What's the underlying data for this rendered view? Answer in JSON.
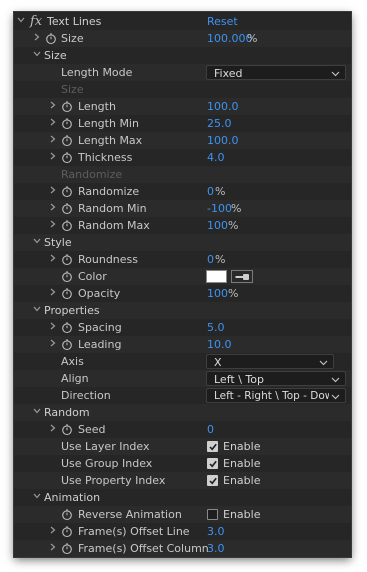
{
  "effect": {
    "name": "Text Lines",
    "reset_label": "Reset"
  },
  "params": {
    "size_root": {
      "label": "Size",
      "value": "100.000",
      "unit": "%"
    },
    "size_group": {
      "label": "Size",
      "length_mode": {
        "label": "Length Mode",
        "value": "Fixed"
      },
      "subhead": "Size",
      "length": {
        "label": "Length",
        "value": "100.0"
      },
      "length_min": {
        "label": "Length Min",
        "value": "25.0"
      },
      "length_max": {
        "label": "Length Max",
        "value": "100.0"
      },
      "thickness": {
        "label": "Thickness",
        "value": "4.0"
      },
      "subhead2": "Randomize",
      "randomize": {
        "label": "Randomize",
        "value": "0",
        "unit": "%"
      },
      "random_min": {
        "label": "Random Min",
        "value": "-100",
        "unit": "%"
      },
      "random_max": {
        "label": "Random Max",
        "value": "100",
        "unit": "%"
      }
    },
    "style_group": {
      "label": "Style",
      "roundness": {
        "label": "Roundness",
        "value": "0",
        "unit": "%"
      },
      "color": {
        "label": "Color",
        "hex": "#ffffff"
      },
      "opacity": {
        "label": "Opacity",
        "value": "100",
        "unit": "%"
      }
    },
    "properties_group": {
      "label": "Properties",
      "spacing": {
        "label": "Spacing",
        "value": "5.0"
      },
      "leading": {
        "label": "Leading",
        "value": "10.0"
      },
      "axis": {
        "label": "Axis",
        "value": "X"
      },
      "align": {
        "label": "Align",
        "value": "Left \\ Top"
      },
      "direction": {
        "label": "Direction",
        "value": "Left - Right \\ Top - Dow"
      }
    },
    "random_group": {
      "label": "Random",
      "seed": {
        "label": "Seed",
        "value": "0"
      },
      "use_layer_index": {
        "label": "Use Layer Index",
        "checked": true,
        "check_label": "Enable"
      },
      "use_group_index": {
        "label": "Use Group Index",
        "checked": true,
        "check_label": "Enable"
      },
      "use_property_index": {
        "label": "Use Property Index",
        "checked": true,
        "check_label": "Enable"
      }
    },
    "animation_group": {
      "label": "Animation",
      "reverse_animation": {
        "label": "Reverse Animation",
        "checked": false,
        "check_label": "Enable"
      },
      "frames_offset_line": {
        "label": "Frame(s) Offset Line",
        "value": "3.0"
      },
      "frames_offset_column": {
        "label": "Frame(s) Offset Column",
        "value": "3.0"
      }
    }
  },
  "colors": {
    "panel_bg": "#232323",
    "value_blue": "#3d93f2",
    "text": "#c8c8c8"
  },
  "icons": [
    "twirl-open-icon",
    "twirl-closed-icon",
    "stopwatch-icon",
    "checkmark-icon",
    "eyedropper-icon",
    "chevron-down-icon"
  ]
}
